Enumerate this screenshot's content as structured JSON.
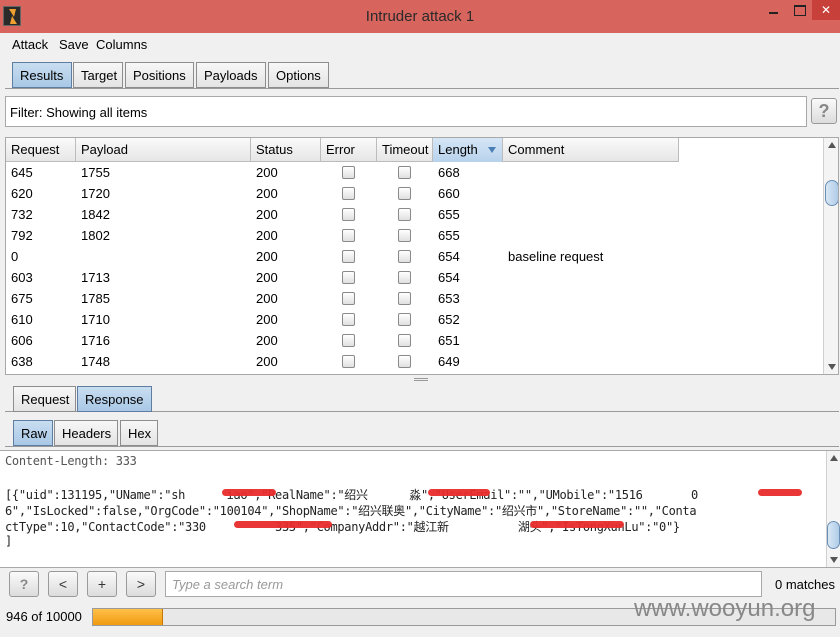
{
  "window": {
    "title": "Intruder attack 1",
    "close_glyph": "✕"
  },
  "menu": [
    "Attack",
    "Save",
    "Columns"
  ],
  "main_tabs": [
    "Results",
    "Target",
    "Positions",
    "Payloads",
    "Options"
  ],
  "filter": {
    "text": "Filter: Showing all items",
    "help": "?"
  },
  "table": {
    "columns": [
      "Request",
      "Payload",
      "Status",
      "Error",
      "Timeout",
      "Length",
      "Comment"
    ],
    "sorted_column": "Length",
    "rows": [
      {
        "request": "645",
        "payload": "1755",
        "status": "200",
        "error": false,
        "timeout": false,
        "length": "668",
        "comment": ""
      },
      {
        "request": "620",
        "payload": "1720",
        "status": "200",
        "error": false,
        "timeout": false,
        "length": "660",
        "comment": ""
      },
      {
        "request": "732",
        "payload": "1842",
        "status": "200",
        "error": false,
        "timeout": false,
        "length": "655",
        "comment": ""
      },
      {
        "request": "792",
        "payload": "1802",
        "status": "200",
        "error": false,
        "timeout": false,
        "length": "655",
        "comment": ""
      },
      {
        "request": "0",
        "payload": "",
        "status": "200",
        "error": false,
        "timeout": false,
        "length": "654",
        "comment": "baseline request"
      },
      {
        "request": "603",
        "payload": "1713",
        "status": "200",
        "error": false,
        "timeout": false,
        "length": "654",
        "comment": ""
      },
      {
        "request": "675",
        "payload": "1785",
        "status": "200",
        "error": false,
        "timeout": false,
        "length": "653",
        "comment": ""
      },
      {
        "request": "610",
        "payload": "1710",
        "status": "200",
        "error": false,
        "timeout": false,
        "length": "652",
        "comment": ""
      },
      {
        "request": "606",
        "payload": "1716",
        "status": "200",
        "error": false,
        "timeout": false,
        "length": "651",
        "comment": ""
      },
      {
        "request": "638",
        "payload": "1748",
        "status": "200",
        "error": false,
        "timeout": false,
        "length": "649",
        "comment": ""
      }
    ]
  },
  "reqresp_tabs": [
    "Request",
    "Response"
  ],
  "view_tabs": [
    "Raw",
    "Headers",
    "Hex"
  ],
  "response": {
    "header_line": "Content-Length: 333",
    "body_lines": [
      "[{\"uid\":131195,\"UName\":\"sh      iao\",\"RealName\":\"绍兴      淼\",\"UserEmail\":\"\",\"UMobile\":\"1516       0",
      "6\",\"IsLocked\":false,\"OrgCode\":\"100104\",\"ShopName\":\"绍兴联奥\",\"CityName\":\"绍兴市\",\"StoreName\":\"\",\"Conta",
      "ctType\":10,\"ContactCode\":\"330          335\",\"CompanyAddr\":\"越江新          湖头\",\"IsTongXunLu\":\"0\"}",
      "]"
    ]
  },
  "search": {
    "help": "?",
    "prev": "<",
    "add": "+",
    "next": ">",
    "placeholder": "Type a search term",
    "matches": "0 matches"
  },
  "progress": {
    "label": "946 of 10000",
    "done": 946,
    "total": 10000
  },
  "watermark": "www.wooyun.org"
}
